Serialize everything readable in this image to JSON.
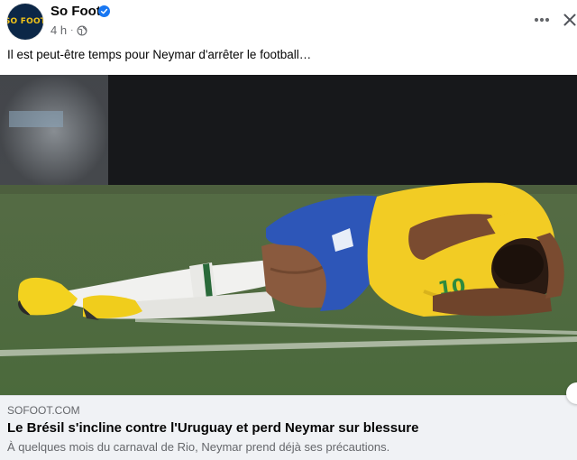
{
  "post": {
    "page_name": "So Foot",
    "avatar_text": "SO FOOT",
    "timestamp": "4 h",
    "separator": "·",
    "text": "Il est peut-être temps pour Neymar d'arrêter le football…",
    "icons": {
      "verified": "verified-badge-icon",
      "audience": "globe-icon",
      "more": "more-horizontal-icon",
      "close": "close-icon"
    }
  },
  "link_preview": {
    "domain": "SOFOOT.COM",
    "title": "Le Brésil s'incline contre l'Uruguay et perd Neymar sur blessure",
    "description": "À quelques mois du carnaval de Rio, Neymar prend déjà ses précautions."
  },
  "colors": {
    "verified_blue": "#1877f2",
    "avatar_bg": "#0c2747",
    "avatar_text": "#f2c419",
    "secondary_text": "#65676b",
    "card_bg": "#f0f2f5"
  }
}
